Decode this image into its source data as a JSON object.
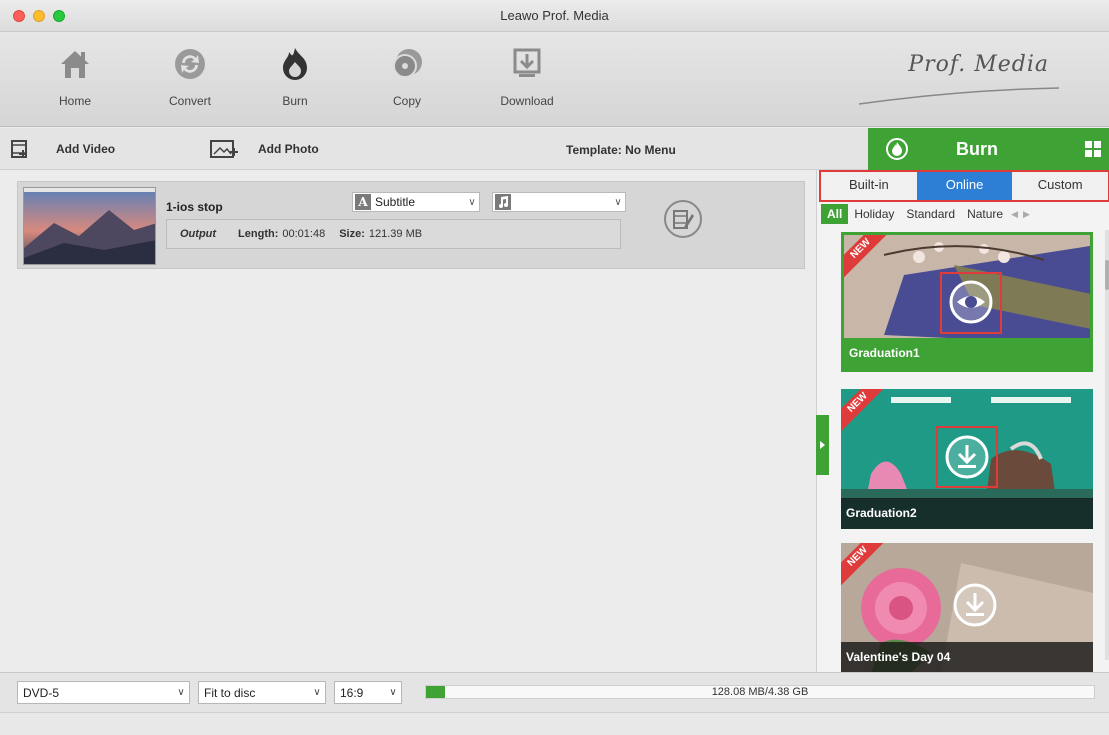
{
  "window": {
    "title": "Leawo Prof. Media"
  },
  "toolbar": {
    "items": [
      {
        "label": "Home",
        "icon": "home-icon"
      },
      {
        "label": "Convert",
        "icon": "convert-icon"
      },
      {
        "label": "Burn",
        "icon": "burn-flame-icon"
      },
      {
        "label": "Copy",
        "icon": "copy-disc-icon"
      },
      {
        "label": "Download",
        "icon": "download-icon"
      }
    ],
    "brand": "Prof. Media"
  },
  "secbar": {
    "add_video": "Add Video",
    "add_photo": "Add Photo",
    "template": "Template: No Menu"
  },
  "burn": {
    "label": "Burn"
  },
  "video": {
    "title": "1-ios stop",
    "subtitle_value": "Subtitle",
    "audio_value": "",
    "output_label": "Output",
    "length_label": "Length:",
    "length": "00:01:48",
    "size_label": "Size:",
    "size": "121.39 MB"
  },
  "panel": {
    "tabs": [
      {
        "label": "Built-in",
        "active": false
      },
      {
        "label": "Online",
        "active": true
      },
      {
        "label": "Custom",
        "active": false
      }
    ],
    "categories": [
      "All",
      "Holiday",
      "Standard",
      "Nature"
    ],
    "new_badge": "NEW",
    "templates": [
      {
        "name": "Graduation1",
        "selected": true
      },
      {
        "name": "Graduation2",
        "selected": false
      },
      {
        "name": "Valentine's Day 04",
        "selected": false
      }
    ]
  },
  "bottom": {
    "disc_type": "DVD-5",
    "fit": "Fit to disc",
    "aspect": "16:9",
    "capacity_text": "128.08 MB/4.38 GB",
    "capacity_fraction": 0.029
  },
  "colors": {
    "accent_green": "#3ea334",
    "tab_blue": "#2d7fd6",
    "highlight_red": "#e03b3b"
  }
}
